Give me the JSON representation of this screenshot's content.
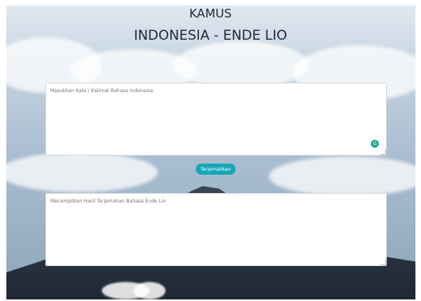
{
  "header": {
    "title": "KAMUS",
    "subtitle": "INDONESIA - ENDE LIO"
  },
  "input_box": {
    "placeholder": "Masukkan Kata / Kalimat Bahasa Indonesia"
  },
  "translate_button": {
    "label": "Terjemahkan"
  },
  "output_box": {
    "placeholder": "Menampilkan Hasil Terjemahan Bahasa Ende Lio"
  },
  "icons": {
    "grammar_check": "grammar-check-icon",
    "grammar_check_glyph": "G"
  },
  "colors": {
    "button": "#16a6b6",
    "grammar_icon": "#14a388",
    "title_text": "#1f2a36"
  }
}
